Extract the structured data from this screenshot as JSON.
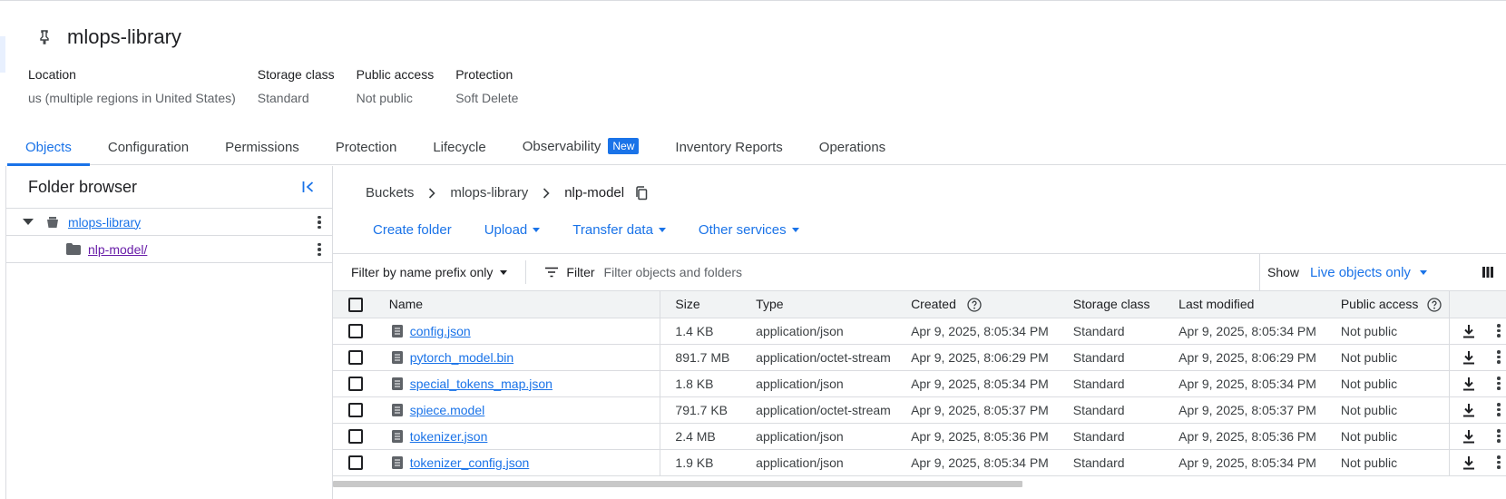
{
  "bucket": {
    "name": "mlops-library"
  },
  "properties": [
    {
      "label": "Location",
      "value": "us (multiple regions in United States)"
    },
    {
      "label": "Storage class",
      "value": "Standard"
    },
    {
      "label": "Public access",
      "value": "Not public"
    },
    {
      "label": "Protection",
      "value": "Soft Delete"
    }
  ],
  "tabs": [
    {
      "label": "Objects"
    },
    {
      "label": "Configuration"
    },
    {
      "label": "Permissions"
    },
    {
      "label": "Protection"
    },
    {
      "label": "Lifecycle"
    },
    {
      "label": "Observability",
      "badge": "New"
    },
    {
      "label": "Inventory Reports"
    },
    {
      "label": "Operations"
    }
  ],
  "folder_browser": {
    "title": "Folder browser",
    "items": [
      {
        "label": "mlops-library"
      },
      {
        "label": "nlp-model/"
      }
    ]
  },
  "breadcrumb": {
    "items": [
      "Buckets",
      "mlops-library"
    ],
    "current": "nlp-model"
  },
  "actions": {
    "create_folder": "Create folder",
    "upload": "Upload",
    "transfer_data": "Transfer data",
    "other_services": "Other services"
  },
  "filterbar": {
    "prefix_mode": "Filter by name prefix only",
    "filter_label": "Filter",
    "filter_placeholder": "Filter objects and folders",
    "show_label": "Show",
    "show_value": "Live objects only"
  },
  "table": {
    "headers": {
      "name": "Name",
      "size": "Size",
      "type": "Type",
      "created": "Created",
      "storage_class": "Storage class",
      "last_modified": "Last modified",
      "public_access": "Public access"
    },
    "rows": [
      {
        "name": "config.json",
        "size": "1.4 KB",
        "type": "application/json",
        "created": "Apr 9, 2025, 8:05:34 PM",
        "storage_class": "Standard",
        "last_modified": "Apr 9, 2025, 8:05:34 PM",
        "public_access": "Not public"
      },
      {
        "name": "pytorch_model.bin",
        "size": "891.7 MB",
        "type": "application/octet-stream",
        "created": "Apr 9, 2025, 8:06:29 PM",
        "storage_class": "Standard",
        "last_modified": "Apr 9, 2025, 8:06:29 PM",
        "public_access": "Not public"
      },
      {
        "name": "special_tokens_map.json",
        "size": "1.8 KB",
        "type": "application/json",
        "created": "Apr 9, 2025, 8:05:34 PM",
        "storage_class": "Standard",
        "last_modified": "Apr 9, 2025, 8:05:34 PM",
        "public_access": "Not public"
      },
      {
        "name": "spiece.model",
        "size": "791.7 KB",
        "type": "application/octet-stream",
        "created": "Apr 9, 2025, 8:05:37 PM",
        "storage_class": "Standard",
        "last_modified": "Apr 9, 2025, 8:05:37 PM",
        "public_access": "Not public"
      },
      {
        "name": "tokenizer.json",
        "size": "2.4 MB",
        "type": "application/json",
        "created": "Apr 9, 2025, 8:05:36 PM",
        "storage_class": "Standard",
        "last_modified": "Apr 9, 2025, 8:05:36 PM",
        "public_access": "Not public"
      },
      {
        "name": "tokenizer_config.json",
        "size": "1.9 KB",
        "type": "application/json",
        "created": "Apr 9, 2025, 8:05:34 PM",
        "storage_class": "Standard",
        "last_modified": "Apr 9, 2025, 8:05:34 PM",
        "public_access": "Not public"
      }
    ]
  },
  "colors": {
    "accent": "#1a73e8",
    "visited_link": "#681da8",
    "border": "#dadce0",
    "header_bg": "#f1f3f4"
  }
}
